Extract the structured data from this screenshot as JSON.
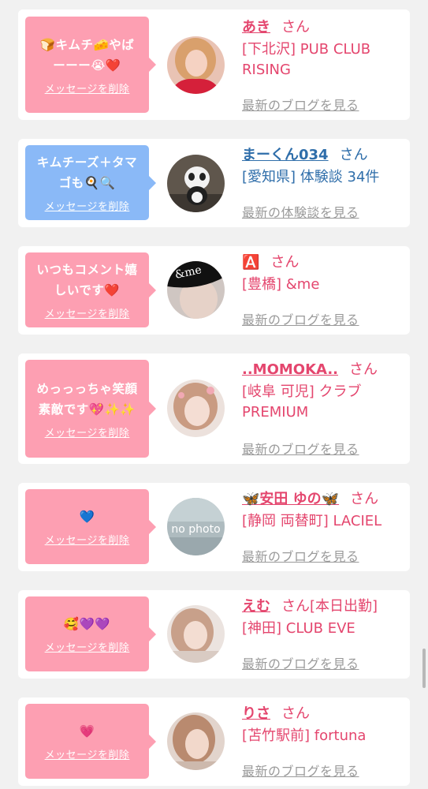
{
  "cards": [
    {
      "message": "🍞キムチ🧀やばーーー😭❤️",
      "delete_label": "メッセージを削除",
      "name": "あき",
      "honorific": "さん",
      "location": "[下北沢] PUB CLUB RISING",
      "blog_link": "最新のブログを見る"
    },
    {
      "message": "キムチーズ＋タマゴも🍳🔍",
      "delete_label": "メッセージを削除",
      "name": "まーくん034",
      "honorific": "さん",
      "location": "[愛知県] 体験談 34件",
      "blog_link": "最新の体験談を見る"
    },
    {
      "message": "いつもコメント嬉しいです❤️",
      "delete_label": "メッセージを削除",
      "name": "🅰️",
      "honorific": "さん",
      "location": "[豊橋] &me",
      "blog_link": "最新のブログを見る",
      "avatar_text": "&me"
    },
    {
      "message": "めっっっちゃ笑顔素敵です💖✨✨",
      "delete_label": "メッセージを削除",
      "name": "..MOMOKA..",
      "honorific": "さん",
      "location": "[岐阜 可児] クラブ PREMIUM",
      "blog_link": "最新のブログを見る"
    },
    {
      "message": "💙",
      "delete_label": "メッセージを削除",
      "name": "🦋安田 ゆの🦋",
      "honorific": "さん",
      "location": "[静岡 両替町] LACIEL",
      "blog_link": "最新のブログを見る",
      "avatar_text": "no photo"
    },
    {
      "message": "🥰💜💜",
      "delete_label": "メッセージを削除",
      "name": "えむ",
      "honorific": "さん[本日出勤]",
      "location": "[神田] CLUB EVE",
      "blog_link": "最新のブログを見る"
    },
    {
      "message": "💗",
      "delete_label": "メッセージを削除",
      "name": "りさ",
      "honorific": "さん",
      "location": "[苫竹駅前] fortuna",
      "blog_link": "最新のブログを見る"
    }
  ],
  "colors": {
    "accent_pink": "#e4466e",
    "accent_blue": "#2f6eaa",
    "bubble_pink": "#fd9fb2",
    "bubble_blue": "#8ab9f7"
  }
}
